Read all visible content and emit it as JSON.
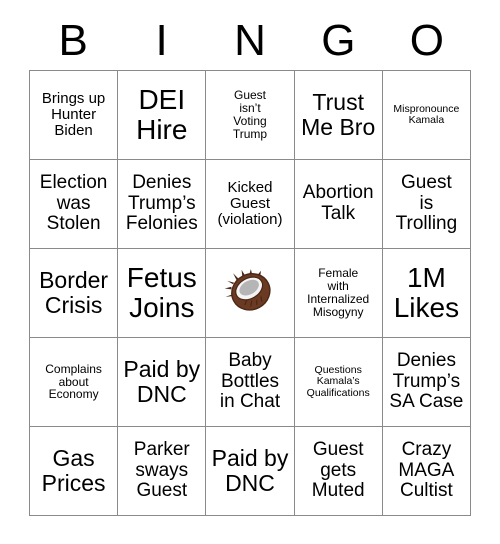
{
  "header": {
    "letters": [
      "B",
      "I",
      "N",
      "G",
      "O"
    ]
  },
  "grid": {
    "rows": 5,
    "columns": 5,
    "border_color": "#8a8a8a",
    "cell_background": "#ffffff",
    "text_color": "#000000",
    "cells": [
      [
        {
          "text": "Brings up\nHunter\nBiden",
          "size": "sm"
        },
        {
          "text": "DEI\nHire",
          "size": "xl"
        },
        {
          "text": "Guest\nisn’t\nVoting\nTrump",
          "size": "xs"
        },
        {
          "text": "Trust\nMe Bro",
          "size": "lg"
        },
        {
          "text": "Mispronounce\nKamala",
          "size": "xxs"
        }
      ],
      [
        {
          "text": "Election\nwas\nStolen",
          "size": "md"
        },
        {
          "text": "Denies\nTrump’s\nFelonies",
          "size": "md"
        },
        {
          "text": "Kicked\nGuest\n(violation)",
          "size": "sm"
        },
        {
          "text": "Abortion\nTalk",
          "size": "md"
        },
        {
          "text": "Guest\nis\nTrolling",
          "size": "md"
        }
      ],
      [
        {
          "text": "Border\nCrisis",
          "size": "lg"
        },
        {
          "text": "Fetus\nJoins",
          "size": "xl"
        },
        {
          "text": "",
          "size": "md",
          "icon": "coconut-emoji",
          "free_space": true
        },
        {
          "text": "Female\nwith\nInternalized\nMisogyny",
          "size": "xs"
        },
        {
          "text": "1M\nLikes",
          "size": "xl"
        }
      ],
      [
        {
          "text": "Complains\nabout\nEconomy",
          "size": "xs"
        },
        {
          "text": "Paid by\nDNC",
          "size": "lg"
        },
        {
          "text": "Baby\nBottles\nin Chat",
          "size": "md"
        },
        {
          "text": "Questions\nKamala’s\nQualifications",
          "size": "xxs"
        },
        {
          "text": "Denies\nTrump’s\nSA Case",
          "size": "md"
        }
      ],
      [
        {
          "text": "Gas\nPrices",
          "size": "lg"
        },
        {
          "text": "Parker\nsways\nGuest",
          "size": "md"
        },
        {
          "text": "Paid by\nDNC",
          "size": "lg"
        },
        {
          "text": "Guest\ngets\nMuted",
          "size": "md"
        },
        {
          "text": "Crazy\nMAGA\nCultist",
          "size": "md"
        }
      ]
    ]
  },
  "free_space": {
    "icon_name": "coconut-emoji",
    "shell_color": "#6b3a22",
    "shell_dark": "#4a2716",
    "flesh_color": "#f2f2f2",
    "inner_color": "#b5b5b5"
  }
}
